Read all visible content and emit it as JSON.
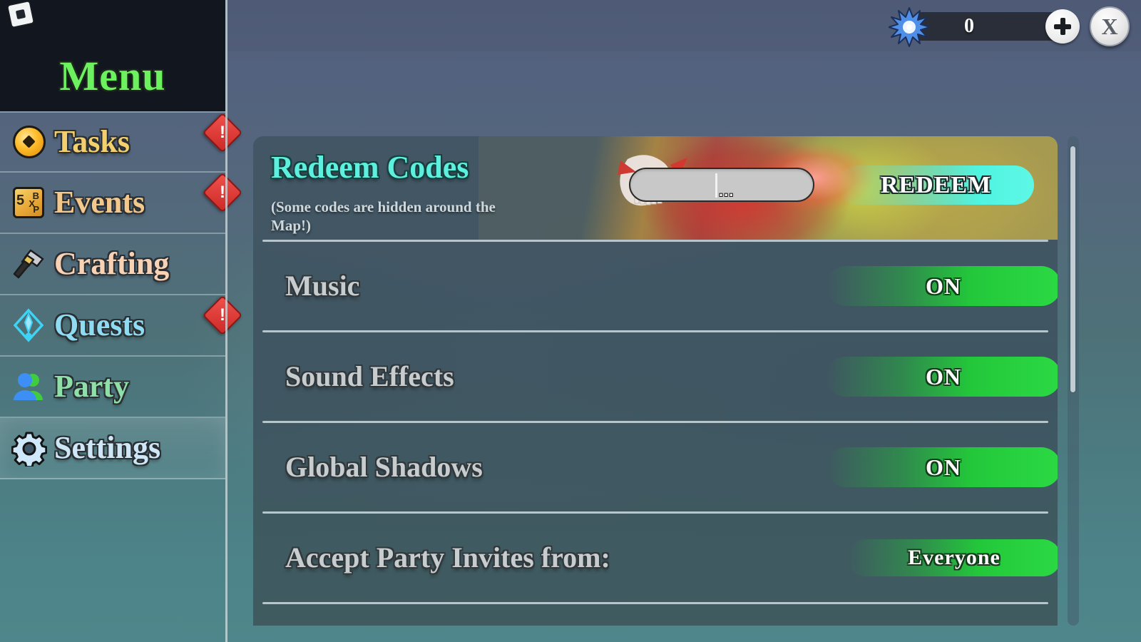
{
  "window": {
    "logo": "roblox-logo"
  },
  "sidebar": {
    "title": "Menu",
    "items": [
      {
        "label": "Tasks",
        "icon": "coin-icon",
        "badge": "!",
        "has_badge": true,
        "active": false
      },
      {
        "label": "Events",
        "icon": "events-icon",
        "badge": "!",
        "has_badge": true,
        "active": false
      },
      {
        "label": "Crafting",
        "icon": "hammer-icon",
        "badge": "",
        "has_badge": false,
        "active": false
      },
      {
        "label": "Quests",
        "icon": "quest-icon",
        "badge": "!",
        "has_badge": true,
        "active": false
      },
      {
        "label": "Party",
        "icon": "party-icon",
        "badge": "",
        "has_badge": false,
        "active": false
      },
      {
        "label": "Settings",
        "icon": "gear-icon",
        "badge": "",
        "has_badge": false,
        "active": true
      }
    ]
  },
  "topbar": {
    "currency_icon": "star-burst-icon",
    "currency_value": "0",
    "add_label": "+",
    "close_label": "X"
  },
  "redeem": {
    "title": "Redeem Codes",
    "subtitle": "(Some codes are hidden around the Map!)",
    "input_value": "...",
    "input_placeholder": "...",
    "button_label": "REDEEM"
  },
  "settings": {
    "rows": [
      {
        "label": "Music",
        "value": "ON"
      },
      {
        "label": "Sound Effects",
        "value": "ON"
      },
      {
        "label": "Global Shadows",
        "value": "ON"
      },
      {
        "label": "Accept Party Invites from:",
        "value": "Everyone"
      }
    ]
  },
  "colors": {
    "menu_title": "#6cf25f",
    "redeem_title": "#5ef0de",
    "toggle_on": "#23c83a",
    "badge_red": "#cc2a26",
    "panel_bg": "#3d5260"
  }
}
